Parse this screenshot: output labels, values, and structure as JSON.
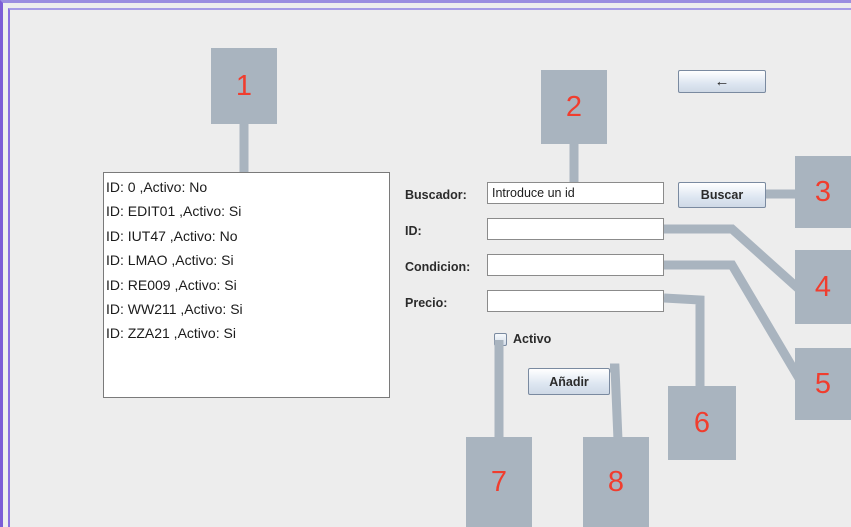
{
  "list": {
    "items": [
      "ID: 0 ,Activo: No",
      "ID: EDIT01 ,Activo: Si",
      "ID: IUT47 ,Activo: No",
      "ID: LMAO ,Activo: Si",
      "ID: RE009 ,Activo: Si",
      "ID: WW211 ,Activo: Si",
      "ID: ZZA21 ,Activo: Si"
    ]
  },
  "form": {
    "back_icon": "←",
    "buscador_label": "Buscador:",
    "buscador_value": "Introduce un id",
    "buscar_label": "Buscar",
    "id_label": "ID:",
    "id_value": "",
    "condicion_label": "Condicion:",
    "condicion_value": "",
    "precio_label": "Precio:",
    "precio_value": "",
    "activo_label": "Activo",
    "activo_checked": false,
    "anadir_label": "Añadir"
  },
  "annotations": {
    "n1": "1",
    "n2": "2",
    "n3": "3",
    "n4": "4",
    "n5": "5",
    "n6": "6",
    "n7": "7",
    "n8": "8"
  },
  "colors": {
    "annotation_box": "#a9b4bf",
    "annotation_number": "#f03d2e",
    "window_border": "#7c5cd6"
  }
}
